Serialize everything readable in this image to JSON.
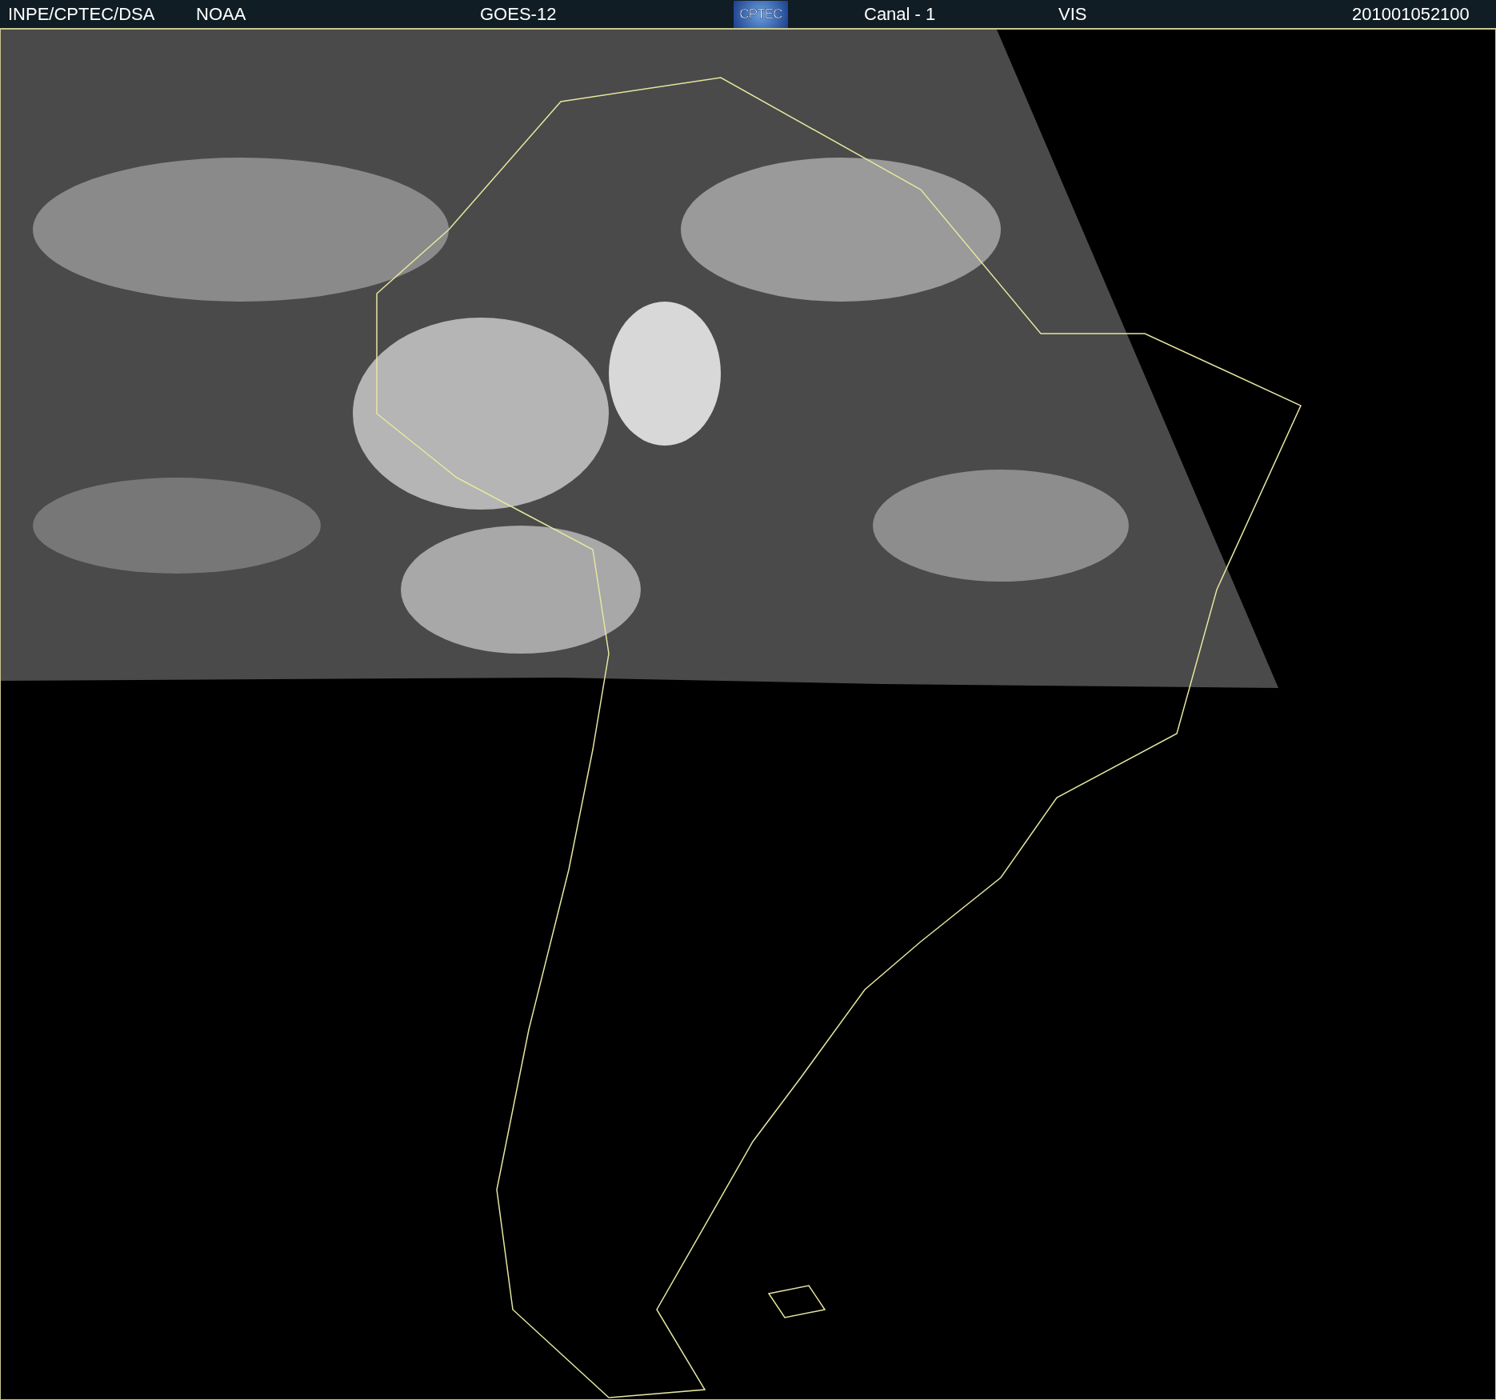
{
  "header": {
    "source": "INPE/CPTEC/DSA",
    "agency": "NOAA",
    "satellite": "GOES-12",
    "logo": "CPTEC",
    "channel": "Canal - 1",
    "band": "VIS",
    "timestamp": "201001052100"
  }
}
